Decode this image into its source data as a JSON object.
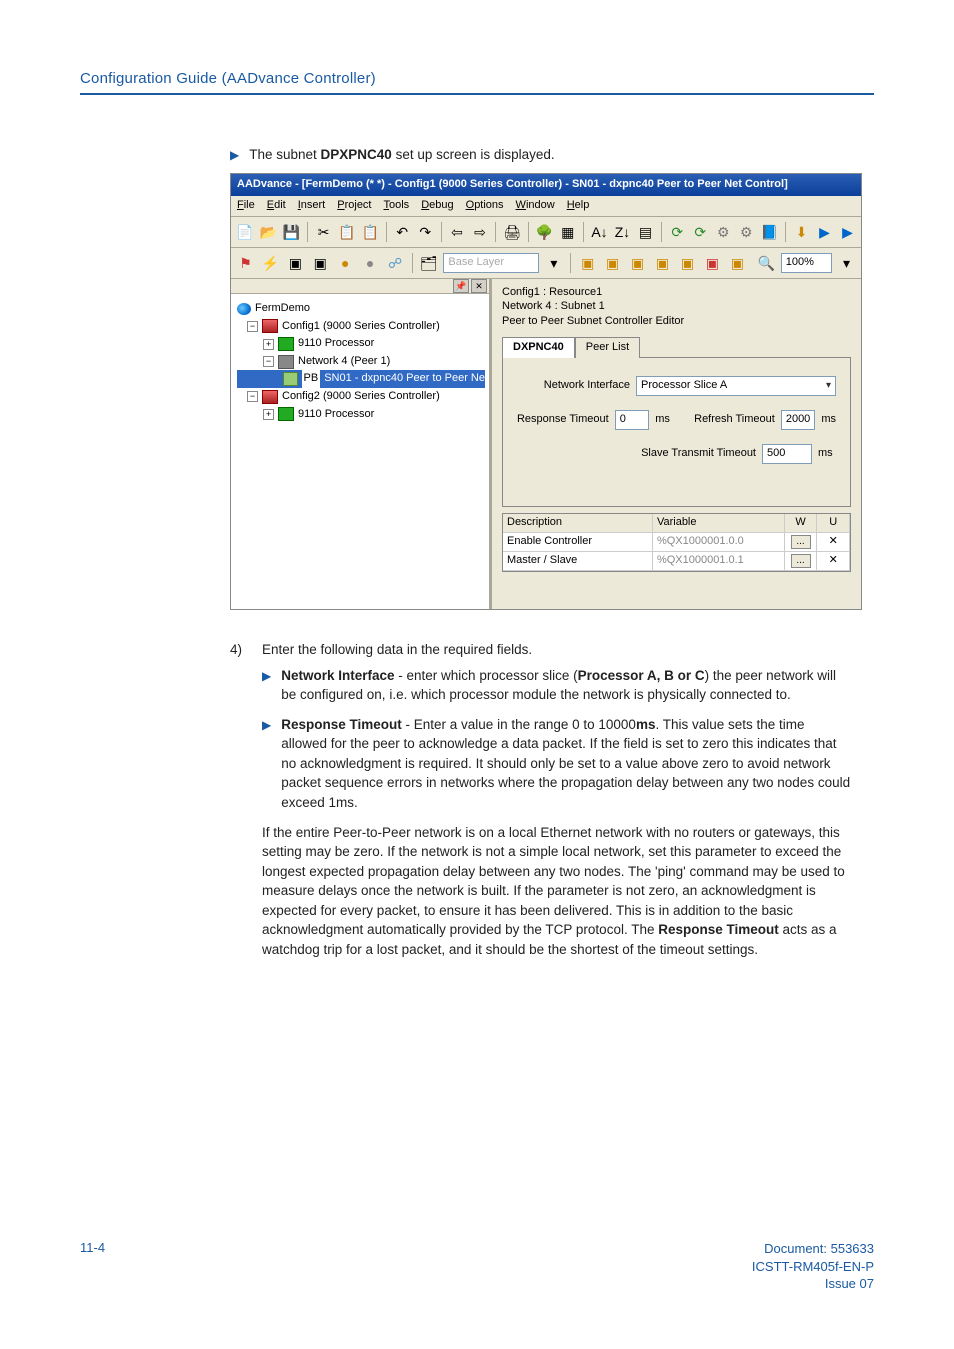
{
  "header": {
    "title": "Configuration Guide (AADvance Controller)"
  },
  "intro": {
    "prefix": "The subnet ",
    "bold": "DPXPNC40",
    "suffix": " set up screen is displayed."
  },
  "win": {
    "title": "AADvance - [FermDemo (*  *) - Config1 (9000 Series Controller) - SN01 - dxpnc40 Peer to Peer Net Control]",
    "menu": {
      "file": "File",
      "edit": "Edit",
      "insert": "Insert",
      "project": "Project",
      "tools": "Tools",
      "debug": "Debug",
      "options": "Options",
      "window": "Window",
      "help": "Help"
    },
    "layer_label": "Base Layer",
    "zoom": "100%",
    "minibar": {
      "pin": "📌",
      "close": "✕"
    },
    "tree": {
      "root": "FermDemo",
      "n1": "Config1 (9000 Series Controller)",
      "n1a": "9110 Processor",
      "n1b": "Network 4 (Peer 1)",
      "n1b1": "SN01 - dxpnc40 Peer to Peer Ne",
      "pb": "PB",
      "n2": "Config2 (9000 Series Controller)",
      "n2a": "9110 Processor"
    },
    "right": {
      "l1": "Config1 : Resource1",
      "l2": "Network 4 : Subnet 1",
      "l3": "Peer to Peer Subnet Controller Editor",
      "tabs": {
        "t1": "DXPNC40",
        "t2": "Peer List"
      },
      "ni_label": "Network Interface",
      "ni_value": "Processor Slice A",
      "rt_label": "Response Timeout",
      "rt_value": "0",
      "rt_unit": "ms",
      "rf_label": "Refresh Timeout",
      "rf_value": "2000",
      "rf_unit": "ms",
      "stt_label": "Slave Transmit Timeout",
      "stt_value": "500",
      "stt_unit": "ms",
      "table": {
        "h_desc": "Description",
        "h_var": "Variable",
        "h_w": "W",
        "h_u": "U",
        "r1_desc": "Enable Controller",
        "r1_var": "%QX1000001.0.0",
        "r1_btn": "...",
        "r1_u": "✕",
        "r2_desc": "Master / Slave",
        "r2_var": "%QX1000001.0.1",
        "r2_btn": "...",
        "r2_u": "✕"
      }
    }
  },
  "step4": {
    "num": "4)",
    "text": "Enter the following data in the required fields."
  },
  "bullet1": {
    "b1": "Network Interface",
    "mid1": " - enter which processor slice (",
    "b2": "Processor A, B or C",
    "mid2": ") the peer network will be configured on, i.e. which processor module the network is physically connected to."
  },
  "bullet2": {
    "b1": "Response Timeout",
    "mid1": " - Enter a value in the range 0 to 10000",
    "b2": "ms",
    "rest": ". This value sets the time allowed for the peer to acknowledge a data packet. If the field is set to zero this indicates that no acknowledgment is required. It should only be set to a value above zero to avoid network packet sequence errors in networks where the propagation delay between any two nodes could exceed 1ms."
  },
  "para": {
    "p1a": "If the entire Peer-to-Peer network is on a local Ethernet network with no routers or gateways, this setting may be zero. If the network is not a simple local network, set this parameter to exceed the longest expected propagation delay between any two nodes. The 'ping' command may be used to measure delays once the network is built. If the parameter is not zero, an acknowledgment is expected for every packet, to ensure it has been delivered. This is in addition to the basic acknowledgment automatically provided by the TCP protocol. The ",
    "b": "Response Timeout",
    "p1b": " acts as a watchdog trip for a lost packet, and it should be the shortest of the timeout settings."
  },
  "footer": {
    "page": "11-4",
    "doc": "Document: 553633",
    "code": "ICSTT-RM405f-EN-P",
    "issue": "Issue 07"
  },
  "icons": {
    "arrow": "▶",
    "chev": "▾",
    "plus": "+",
    "minus": "−"
  }
}
